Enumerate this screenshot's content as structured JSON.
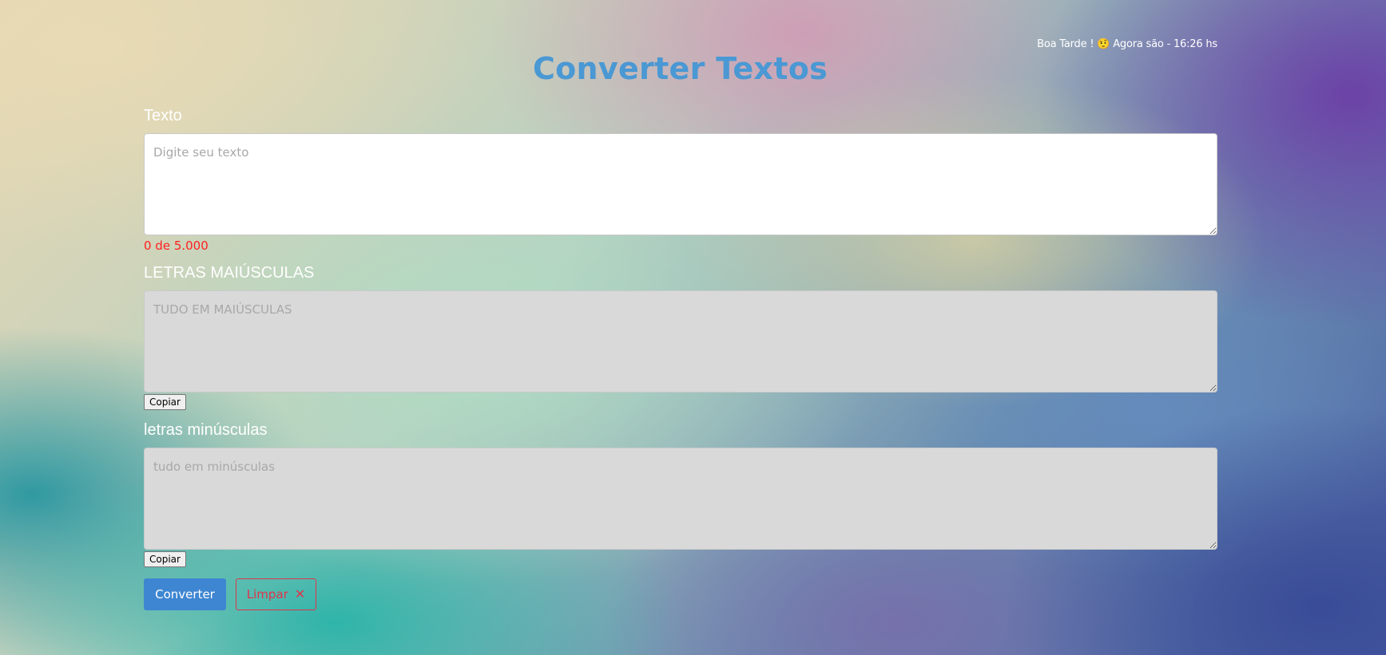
{
  "header": {
    "greeting": "Boa Tarde ! 🤨 Agora são - 16:26 hs",
    "title": "Converter Textos"
  },
  "input_section": {
    "label": "Texto",
    "placeholder": "Digite seu texto",
    "value": "",
    "counter": "0 de 5.000"
  },
  "upper_section": {
    "label": "LETRAS MAIÚSCULAS",
    "placeholder": "TUDO EM MAIÚSCULAS",
    "value": "",
    "copy_label": "Copiar"
  },
  "lower_section": {
    "label": "letras minúsculas",
    "placeholder": "tudo em minúsculas",
    "value": "",
    "copy_label": "Copiar"
  },
  "actions": {
    "convert_label": "Converter",
    "clear_label": "Limpar",
    "clear_icon": "close-icon",
    "clear_icon_glyph": "✕"
  },
  "colors": {
    "title": "#4a98d4",
    "primary": "#3f86d2",
    "danger": "#e0344a",
    "counter": "#ff2020",
    "output_bg": "#d9d9d9"
  }
}
